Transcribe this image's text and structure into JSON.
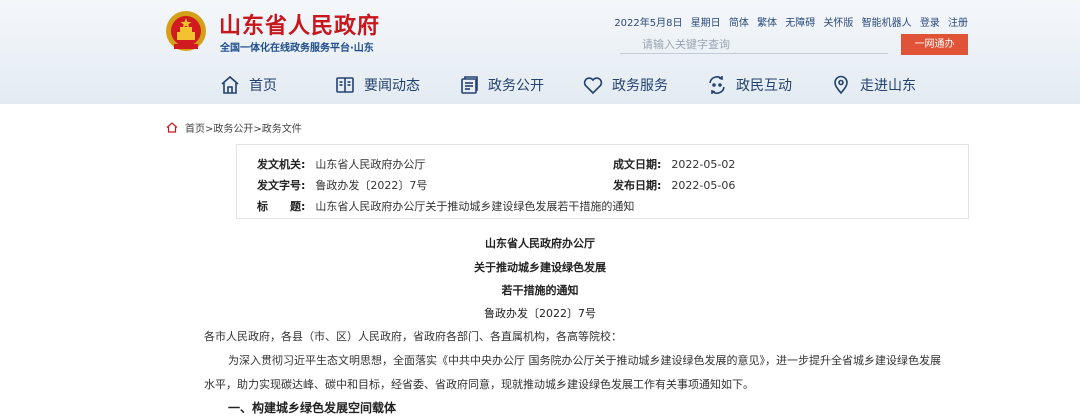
{
  "header": {
    "site_title": "山东省人民政府",
    "site_subtitle": "全国一体化在线政务服务平台·山东",
    "date": "2022年5月8日",
    "weekday": "星期日",
    "links": [
      "简体",
      "繁体",
      "无障碍",
      "关怀版",
      "智能机器人",
      "登录",
      "注册"
    ],
    "search_placeholder": "请输入关键字查询",
    "search_button": "一网通办"
  },
  "nav": {
    "items": [
      {
        "label": "首页",
        "icon": "home-icon"
      },
      {
        "label": "要闻动态",
        "icon": "news-icon"
      },
      {
        "label": "政务公开",
        "icon": "document-icon"
      },
      {
        "label": "政务服务",
        "icon": "heart-icon"
      },
      {
        "label": "政民互动",
        "icon": "interaction-icon"
      },
      {
        "label": "走进山东",
        "icon": "location-icon"
      }
    ]
  },
  "breadcrumb": "首页>政务公开>政务文件",
  "info": {
    "issuer_label": "发文机关:",
    "issuer": "山东省人民政府办公厅",
    "doc_no_label": "发文字号:",
    "doc_no": "鲁政办发〔2022〕7号",
    "title_label": "标　　题:",
    "title": "山东省人民政府办公厅关于推动城乡建设绿色发展若干措施的通知",
    "created_label": "成文日期:",
    "created": "2022-05-02",
    "published_label": "发布日期:",
    "published": "2022-05-06"
  },
  "document": {
    "heading1": "山东省人民政府办公厅",
    "heading2": "关于推动城乡建设绿色发展",
    "heading3": "若干措施的通知",
    "doc_no": "鲁政办发〔2022〕7号",
    "addressee": "各市人民政府，各县（市、区）人民政府，省政府各部门、各直属机构，各高等院校：",
    "para1_line1": "为深入贯彻习近平生态文明思想，全面落实《中共中央办公厅 国务院办公厅关于推动城乡建设绿色发展的意见》，进一步提升全省城乡建设绿色发展",
    "para1_line2": "水平，助力实现碳达峰、碳中和目标，经省委、省政府同意，现就推动城乡建设绿色发展工作有关事项通知如下。",
    "section1": "一、构建城乡绿色发展空间载体"
  },
  "colors": {
    "brand_red": "#c8161d",
    "nav_blue": "#24426e",
    "button_orange": "#e05337"
  }
}
